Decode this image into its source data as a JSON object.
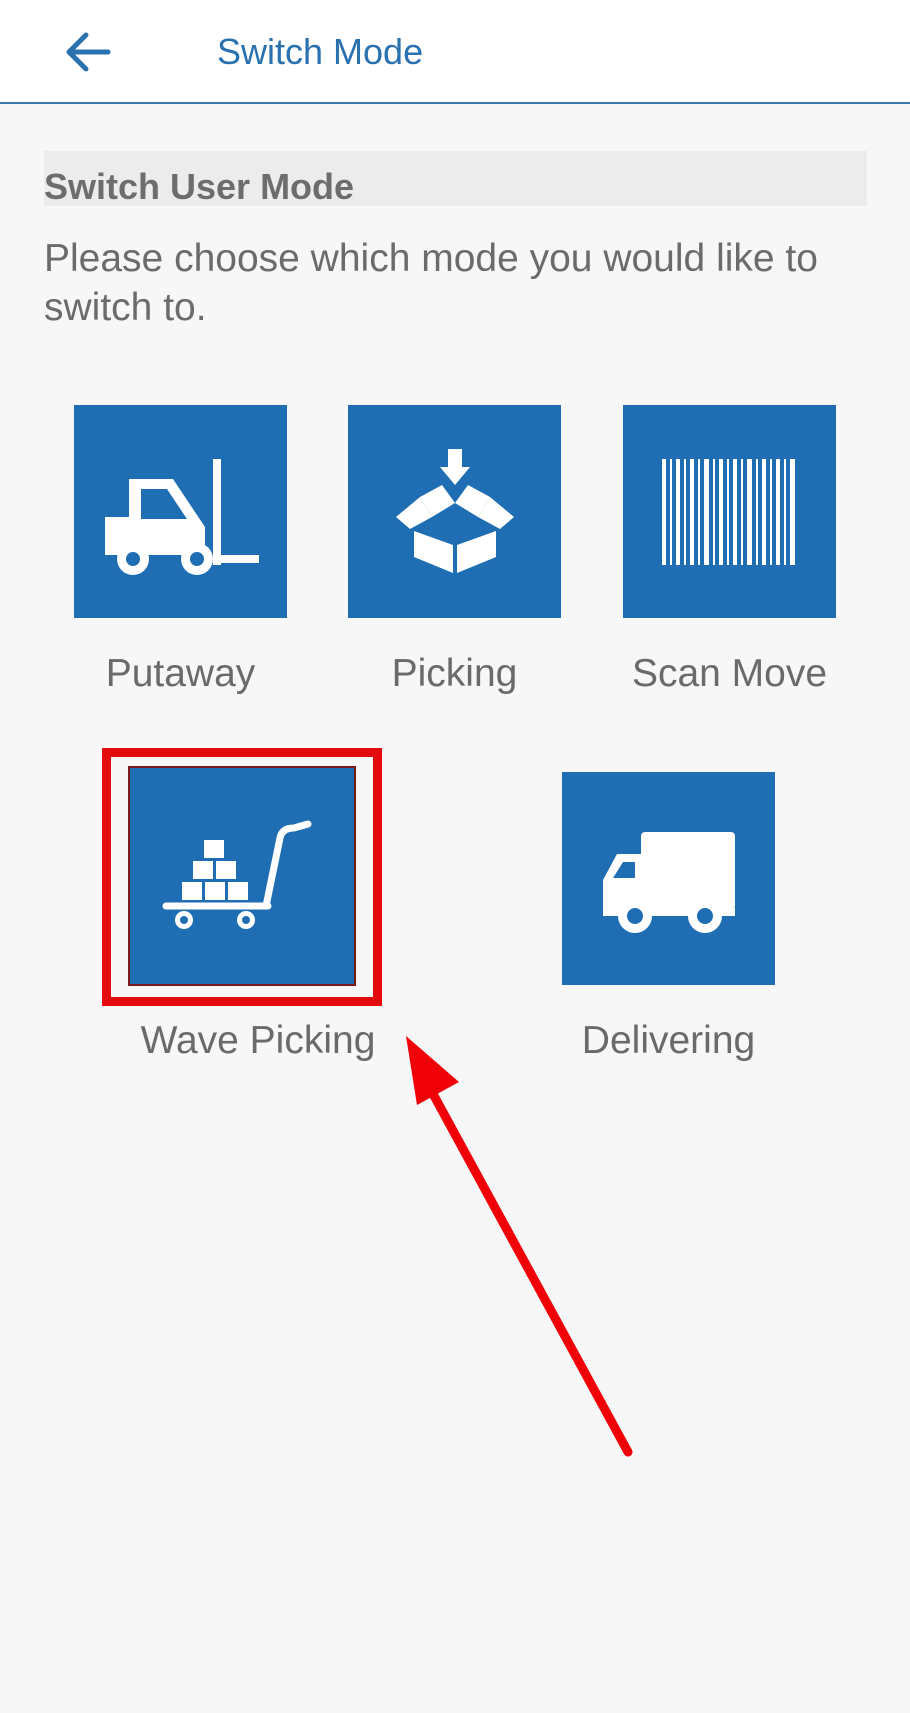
{
  "header": {
    "back_icon": "arrow-left-icon",
    "title": "Switch Mode"
  },
  "section": {
    "title": "Switch User Mode",
    "prompt": "Please choose which mode you would like to switch to."
  },
  "modes": [
    {
      "label": "Putaway",
      "icon": "forklift-icon"
    },
    {
      "label": "Picking",
      "icon": "box-arrow-in-icon"
    },
    {
      "label": "Scan Move",
      "icon": "barcode-icon"
    },
    {
      "label": "Wave Picking",
      "icon": "hand-truck-boxes-icon",
      "highlighted": true
    },
    {
      "label": "Delivering",
      "icon": "delivery-truck-icon"
    }
  ],
  "colors": {
    "accent": "#2a71b0",
    "tile": "#1f6eb3",
    "highlight": "#e40b0f",
    "label_text": "#6a6a6a"
  }
}
